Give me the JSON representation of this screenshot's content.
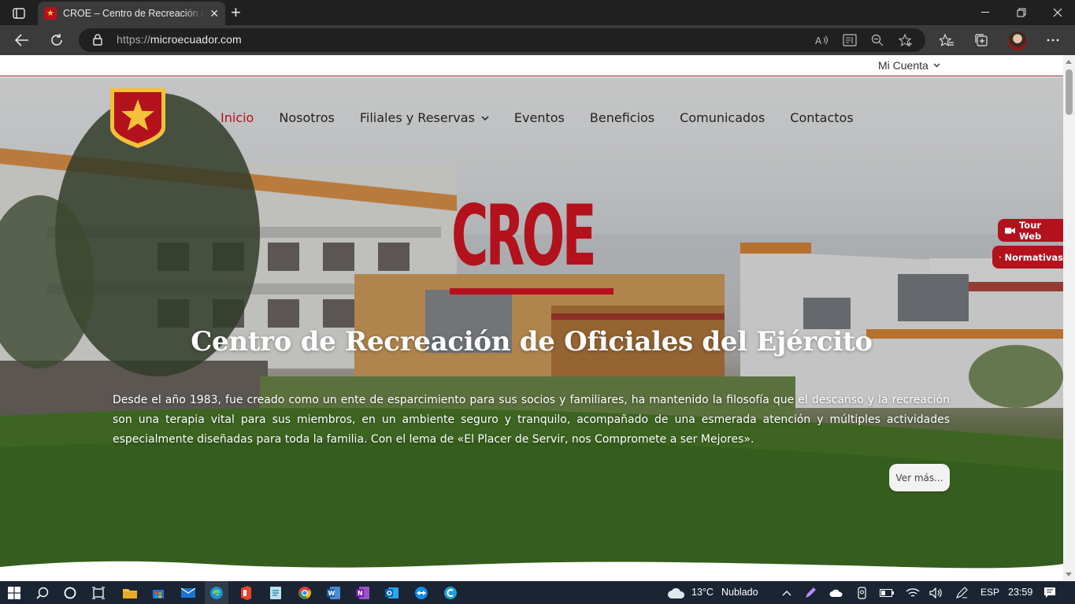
{
  "browser": {
    "tab_title": "CROE – Centro de Recreación de Oficiales del Ejército",
    "url_protocol": "https://",
    "url_host": "microecuador.com"
  },
  "page": {
    "account_label": "Mi Cuenta",
    "nav": [
      {
        "label": "Inicio"
      },
      {
        "label": "Nosotros"
      },
      {
        "label": "Filiales y Reservas"
      },
      {
        "label": "Eventos"
      },
      {
        "label": "Beneficios"
      },
      {
        "label": "Comunicados"
      },
      {
        "label": "Contactos"
      }
    ],
    "brand": "CROE",
    "subtitle": "Centro de Recreación de Oficiales del Ejército",
    "description": "Desde el año 1983, fue creado como un ente de esparcimiento para sus socios y familiares, ha mantenido la filosofía que el descanso y la recreación son una terapia vital para sus miembros, en un ambiente seguro y tranquilo, acompañado de una esmerada atención y múltiples actividades especialmente diseñadas para toda la familia. Con el lema de «El Placer de Servir, nos Compromete a ser Mejores».",
    "more_label": "Ver más...",
    "tour_label": "Tour Web",
    "normativas_label": "Normativas"
  },
  "taskbar": {
    "weather_temp": "13°C",
    "weather_text": "Nublado",
    "language": "ESP",
    "time": "23:59"
  },
  "colors": {
    "brand_red": "#b3121d",
    "gold": "#f3c13a",
    "chrome_dark": "#202020",
    "chrome_mid": "#3b3b3b",
    "taskbar": "#1b2433"
  }
}
